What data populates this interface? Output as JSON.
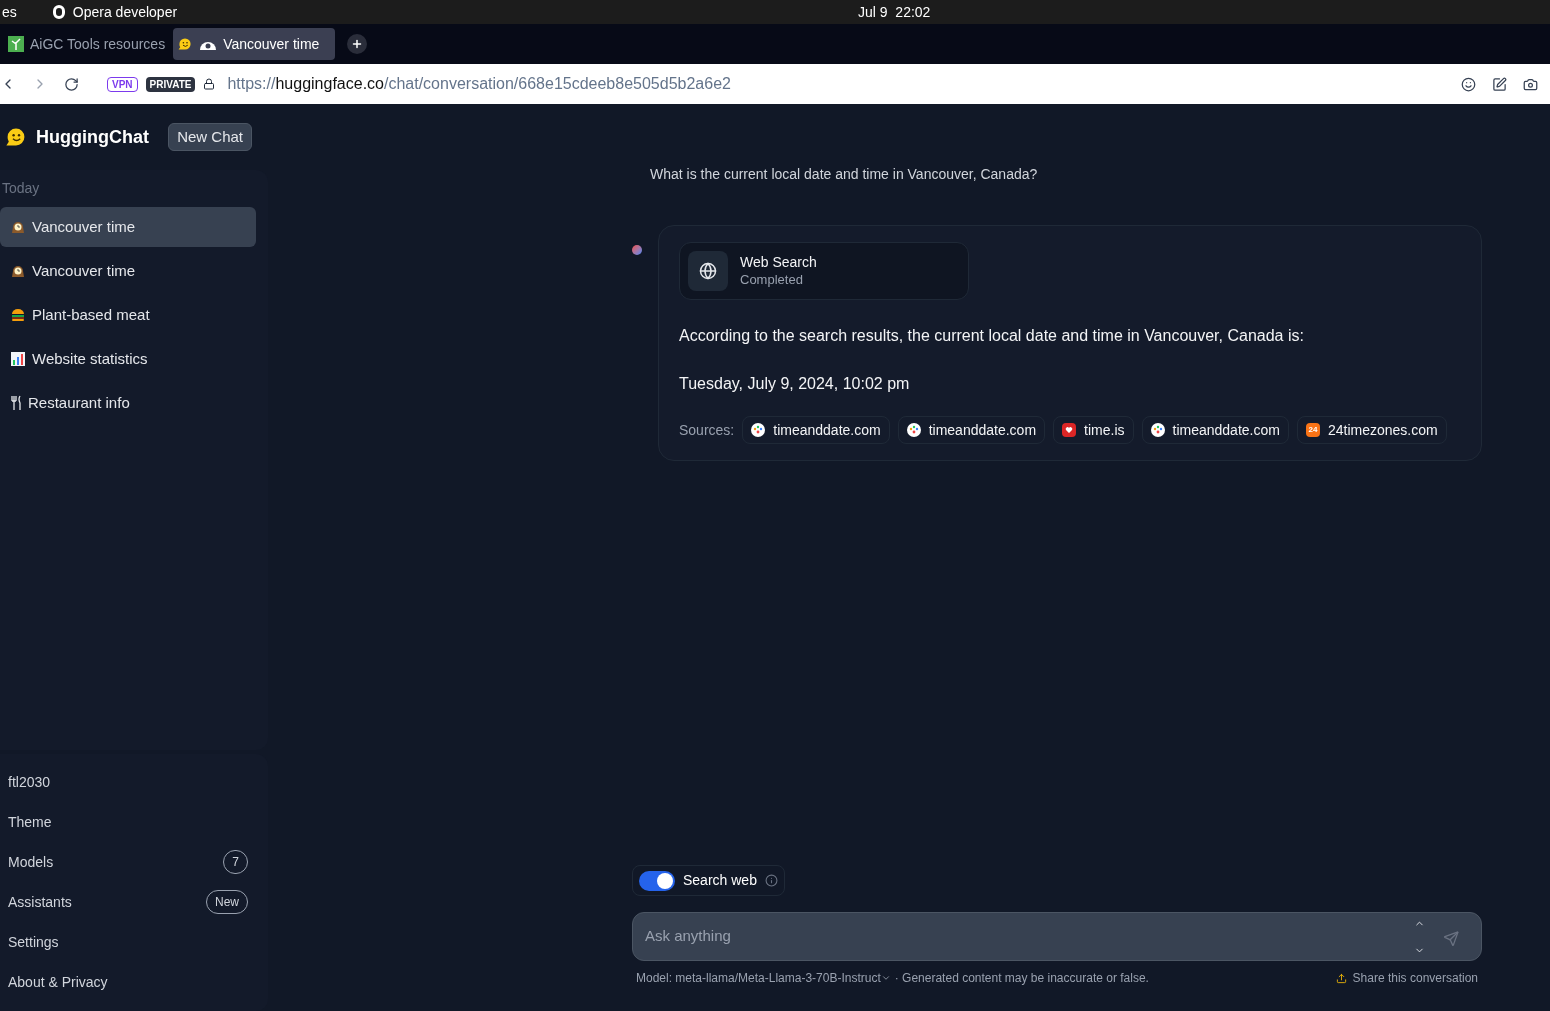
{
  "os_bar": {
    "left": "es",
    "app": "Opera developer",
    "clock": "Jul 9  22:02"
  },
  "browser_tabs": [
    {
      "title": "AiGC Tools resources",
      "selected": false
    },
    {
      "title": "Vancouver time",
      "selected": true
    }
  ],
  "address_bar": {
    "vpn": "VPN",
    "private": "PRIVATE",
    "url_scheme": "https://",
    "url_host": "huggingface.co",
    "url_path": "/chat/conversation/668e15cdeeb8e505d5b2a6e2"
  },
  "app": {
    "name": "HuggingChat",
    "new_chat": "New Chat"
  },
  "history": {
    "group": "Today",
    "items": [
      {
        "title": "Vancouver time",
        "selected": true
      },
      {
        "title": "Vancouver time",
        "selected": false
      },
      {
        "title": "Plant-based meat",
        "selected": false
      },
      {
        "title": "Website statistics",
        "selected": false
      },
      {
        "title": "Restaurant info",
        "selected": false
      }
    ]
  },
  "account": {
    "user": "ftl2030",
    "menu": [
      {
        "label": "Theme"
      },
      {
        "label": "Models",
        "badge": "7"
      },
      {
        "label": "Assistants",
        "badge": "New"
      },
      {
        "label": "Settings"
      },
      {
        "label": "About & Privacy"
      }
    ]
  },
  "conversation": {
    "question": "What is the current local date and time in Vancouver, Canada?",
    "tool": {
      "title": "Web Search",
      "status": "Completed"
    },
    "answer": [
      "According to the search results, the current local date and time in Vancouver, Canada is:",
      "Tuesday, July 9, 2024, 10:02 pm"
    ],
    "sources_label": "Sources:",
    "sources": [
      {
        "name": "timeanddate.com"
      },
      {
        "name": "timeanddate.com"
      },
      {
        "name": "time.is"
      },
      {
        "name": "timeanddate.com"
      },
      {
        "name": "24timezones.com",
        "icon_text": "24"
      }
    ]
  },
  "composer": {
    "search_web": {
      "label": "Search web",
      "on": true
    },
    "placeholder": "Ask anything",
    "model": "Model: meta-llama/Meta-Llama-3-70B-Instruct",
    "disclaimer": "· Generated content may be inaccurate or false.",
    "share": "Share this conversation"
  }
}
